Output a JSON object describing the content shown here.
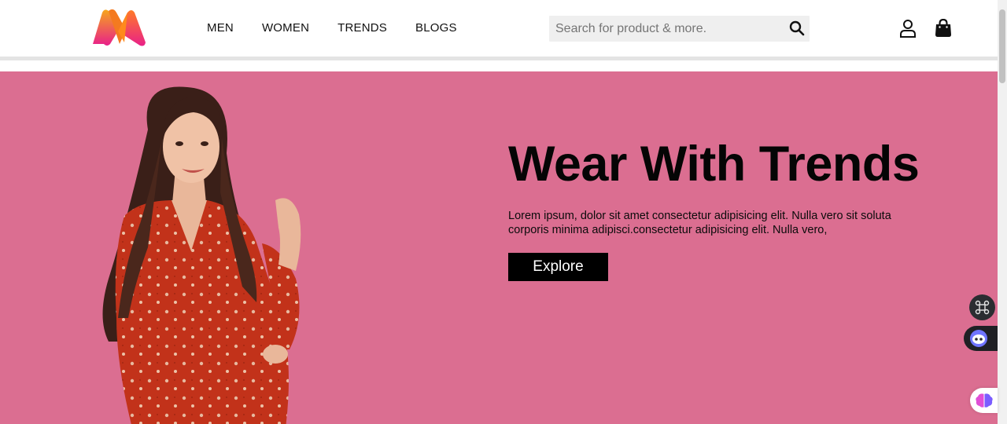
{
  "brand": {
    "logo_icon": "myntra-m-logo-icon",
    "colors": {
      "pink": "#e9247c",
      "orange": "#ff8a1c",
      "hero_bg": "#db6e91"
    }
  },
  "nav": {
    "items": [
      {
        "label": "MEN"
      },
      {
        "label": "WOMEN"
      },
      {
        "label": "TRENDS"
      },
      {
        "label": "BLOGS"
      }
    ]
  },
  "search": {
    "placeholder": "Search for product & more.",
    "value": "",
    "icon": "search-icon"
  },
  "header_icons": {
    "account": "user-icon",
    "cart": "shopping-bag-icon"
  },
  "hero": {
    "title": "Wear With Trends",
    "text": "Lorem ipsum, dolor sit amet consectetur adipisicing elit. Nulla vero sit soluta corporis minima adipisci.consectetur adipisicing elit. Nulla vero,",
    "button_label": "Explore",
    "image": "woman-in-red-floral-dress-image"
  },
  "floating_widgets": [
    "command-icon",
    "assistant-bot-icon",
    "brain-icon"
  ]
}
